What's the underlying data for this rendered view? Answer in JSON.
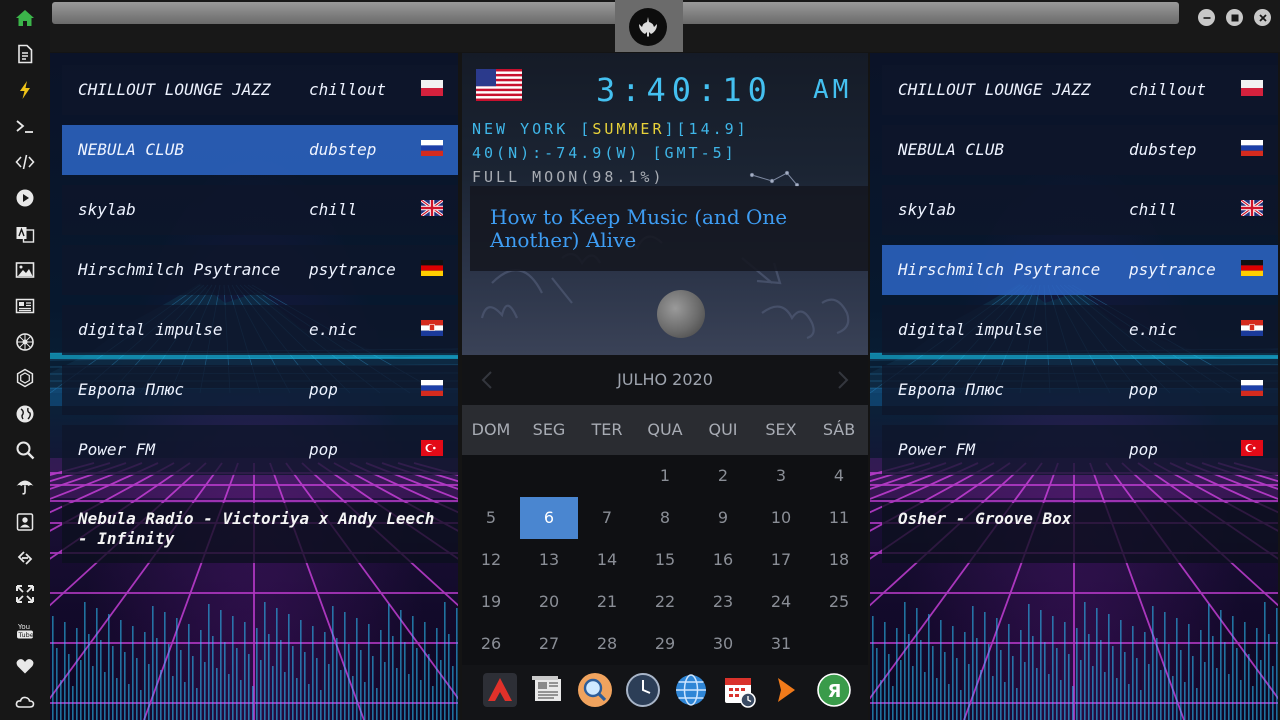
{
  "sidebar": {
    "items": [
      {
        "icon": "home-icon",
        "color": "#3bb54a"
      },
      {
        "icon": "document-icon"
      },
      {
        "icon": "lightning-icon",
        "color": "#f0c419"
      },
      {
        "icon": "terminal-icon"
      },
      {
        "icon": "code-icon"
      },
      {
        "icon": "play-icon"
      },
      {
        "icon": "translate-icon"
      },
      {
        "icon": "image-icon"
      },
      {
        "icon": "newspaper-icon"
      },
      {
        "icon": "jedi-order-icon"
      },
      {
        "icon": "galactic-empire-icon"
      },
      {
        "icon": "globe-icon"
      },
      {
        "icon": "search-icon"
      },
      {
        "icon": "umbrella-icon"
      },
      {
        "icon": "contacts-icon"
      },
      {
        "icon": "link-icon"
      },
      {
        "icon": "expand-arrows-icon"
      },
      {
        "icon": "youtube-icon"
      },
      {
        "icon": "heart-icon"
      },
      {
        "icon": "cloud-icon"
      }
    ]
  },
  "titlebar": {
    "logo_icon": "rebel-alliance-icon",
    "buttons": [
      "minimize-icon",
      "maximize-icon",
      "close-icon"
    ]
  },
  "left_panel": {
    "stations": [
      {
        "name": "CHILLOUT LOUNGE JAZZ",
        "genre": "chillout",
        "flag": "poland"
      },
      {
        "name": "NEBULA CLUB",
        "genre": "dubstep",
        "flag": "russia",
        "selected": true
      },
      {
        "name": "skylab",
        "genre": "chill",
        "flag": "united-kingdom"
      },
      {
        "name": "Hirschmilch Psytrance",
        "genre": "psytrance",
        "flag": "germany"
      },
      {
        "name": "digital impulse",
        "genre": "e.nic",
        "flag": "croatia"
      },
      {
        "name": "Европа Плюс",
        "genre": "pop",
        "flag": "russia"
      },
      {
        "name": "Power FM",
        "genre": "pop",
        "flag": "turkey"
      }
    ],
    "now_playing": "Nebula Radio - Victoriya x Andy Leech - Infinity"
  },
  "right_panel": {
    "stations": [
      {
        "name": "CHILLOUT LOUNGE JAZZ",
        "genre": "chillout",
        "flag": "poland"
      },
      {
        "name": "NEBULA CLUB",
        "genre": "dubstep",
        "flag": "russia"
      },
      {
        "name": "skylab",
        "genre": "chill",
        "flag": "united-kingdom"
      },
      {
        "name": "Hirschmilch Psytrance",
        "genre": "psytrance",
        "flag": "germany",
        "selected": true
      },
      {
        "name": "digital impulse",
        "genre": "e.nic",
        "flag": "croatia"
      },
      {
        "name": "Европа Плюс",
        "genre": "pop",
        "flag": "russia"
      },
      {
        "name": "Power FM",
        "genre": "pop",
        "flag": "turkey"
      }
    ],
    "now_playing": "Osher - Groove Box"
  },
  "clock": {
    "flag": "united-states",
    "time": "3:40:10",
    "ampm": "AM",
    "line1_prefix": "NEW YORK [",
    "line1_highlight": "SUMMER",
    "line1_suffix": "][14.9]",
    "line2": "40(N):-74.9(W) [GMT-5]",
    "line3": "FULL MOON(98.1%)",
    "news_title": "How to Keep Music (and One Another) Alive",
    "colors": {
      "digits": "#44c0f0",
      "highlight": "#e8d23a",
      "moon_text": "#a9adb4"
    }
  },
  "calendar": {
    "month_title": "JULHO 2020",
    "weekdays": [
      "DOM",
      "SEG",
      "TER",
      "QUA",
      "QUI",
      "SEX",
      "SÁB"
    ],
    "weeks": [
      [
        "",
        "",
        "",
        "1",
        "2",
        "3",
        "4"
      ],
      [
        "5",
        "6",
        "7",
        "8",
        "9",
        "10",
        "11"
      ],
      [
        "12",
        "13",
        "14",
        "15",
        "16",
        "17",
        "18"
      ],
      [
        "19",
        "20",
        "21",
        "22",
        "23",
        "24",
        "25"
      ],
      [
        "26",
        "27",
        "28",
        "29",
        "30",
        "31",
        ""
      ]
    ],
    "today": "6",
    "prev_icon": "chevron-left-icon",
    "next_icon": "chevron-right-icon"
  },
  "dock": {
    "apps": [
      "red-triangle-app-icon",
      "newspaper-app-icon",
      "magnifier-app-icon",
      "clock-app-icon",
      "web-browser-icon",
      "calendar-app-icon",
      "orange-arrow-icon",
      "yandex-icon"
    ]
  }
}
